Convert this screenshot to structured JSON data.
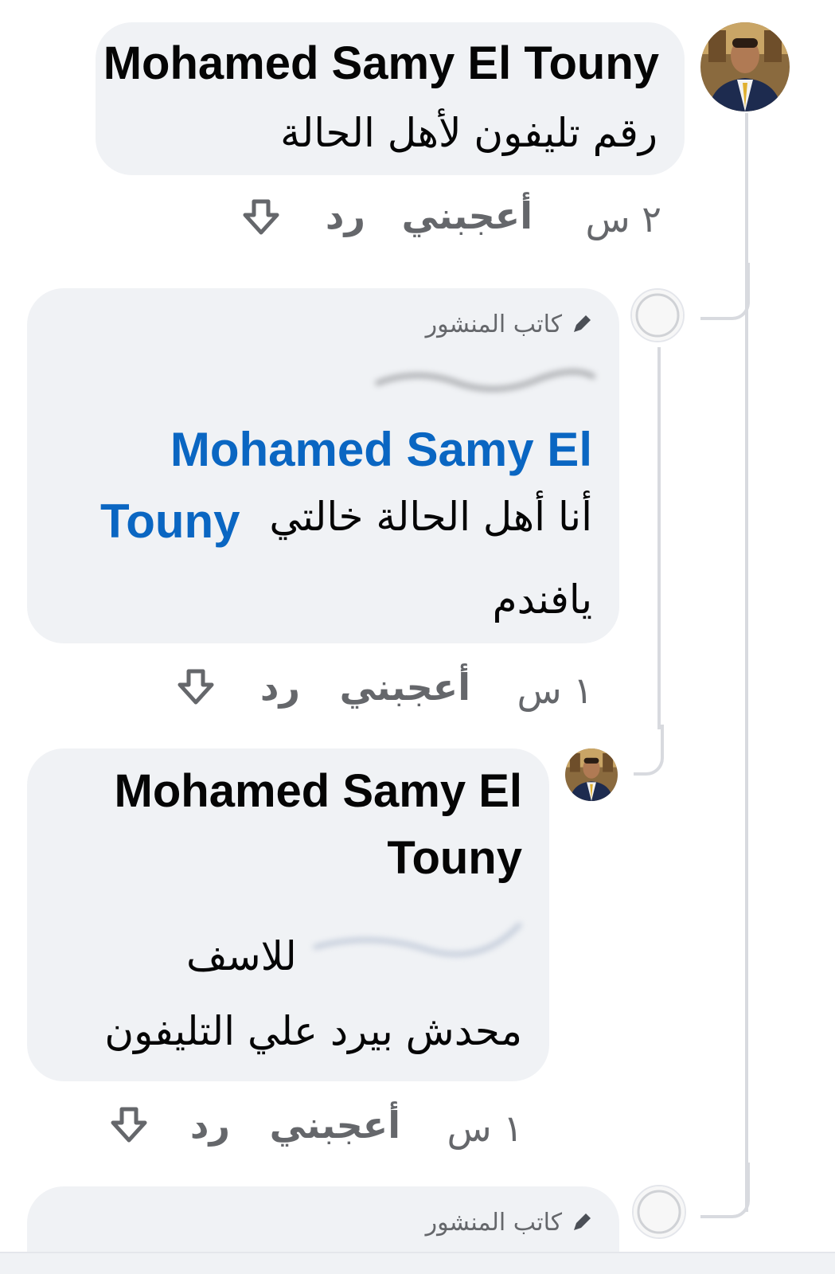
{
  "colors": {
    "bubble_bg": "#f0f2f5",
    "name_text": "#050505",
    "mention": "#0a66c2",
    "meta_text": "#65676b",
    "thread_line": "#d8dadf"
  },
  "comments": [
    {
      "author": "Mohamed Samy El Touny",
      "text": "رقم تليفون لأهل الحالة",
      "time": "٢ س",
      "like_label": "أعجبني",
      "reply_label": "رد",
      "avatar_icon": "profile-photo-icon",
      "reaction_icon": "downvote-arrow-icon"
    },
    {
      "badge_label": "كاتب المنشور",
      "badge_icon": "pencil-icon",
      "mention_line1": "Mohamed Samy El",
      "mention_line2": "Touny",
      "text_line2": "أنا أهل الحالة خالتي",
      "text_line3": "يافندم",
      "time": "١ س",
      "like_label": "أعجبني",
      "reply_label": "رد",
      "avatar_icon": "blank-avatar-icon",
      "reaction_icon": "downvote-arrow-icon"
    },
    {
      "author_line1": "Mohamed Samy El",
      "author_line2": "Touny",
      "text_line1": "للاسف",
      "text_line2": "محدش بيرد علي التليفون",
      "time": "١ س",
      "like_label": "أعجبني",
      "reply_label": "رد",
      "avatar_icon": "profile-photo-icon",
      "reaction_icon": "downvote-arrow-icon"
    },
    {
      "badge_label": "كاتب المنشور",
      "badge_icon": "pencil-icon",
      "avatar_icon": "blank-avatar-icon"
    }
  ]
}
